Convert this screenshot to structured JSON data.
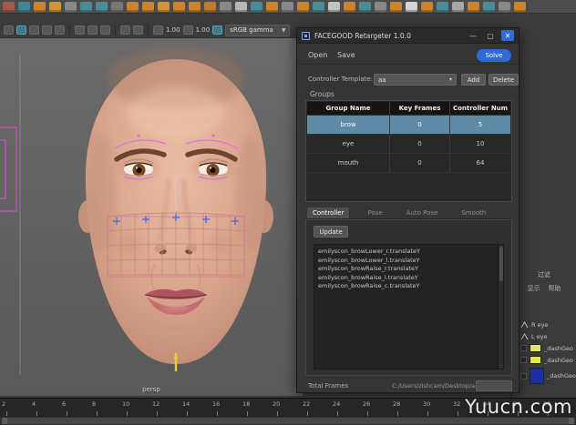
{
  "colors": {
    "accent_blue": "#2f6ad9",
    "selection": "#5e8aa6"
  },
  "watermark": "Yuucn.com",
  "shelf": {
    "icon_colors": [
      "#b05a4a",
      "#3f8e9a",
      "#d9882a",
      "#e09a33",
      "#8f8f8f",
      "#49939e",
      "#49939e",
      "#7a7a7a",
      "#d9882a",
      "#d9882a",
      "#e09a33",
      "#d9882a",
      "#d9882a",
      "#c97f28",
      "#8f8f8f",
      "#bfbfbf",
      "#49939e",
      "#d9882a",
      "#8f8f8f",
      "#d9882a",
      "#49939e",
      "#cccccc",
      "#d9882a",
      "#49939e",
      "#8f8f8f",
      "#d9882a",
      "#e0e0e0",
      "#d9882a",
      "#49939e",
      "#b0b0b0",
      "#d9882a",
      "#49939e",
      "#8f8f8f",
      "#d9882a"
    ]
  },
  "viewport_toolbar": {
    "group1": [
      {
        "name": "camera-select-icon",
        "active": false
      },
      {
        "name": "camera-lock-icon",
        "active": true
      },
      {
        "name": "film-gate-icon",
        "active": false
      },
      {
        "name": "resolution-gate-icon",
        "active": false
      },
      {
        "name": "gate-mask-icon",
        "active": false
      }
    ],
    "group2": [
      {
        "name": "field-chart-icon",
        "active": false
      },
      {
        "name": "safe-action-icon",
        "active": false
      },
      {
        "name": "safe-title-icon",
        "active": false
      }
    ],
    "group3": [
      {
        "name": "isolate-select-icon",
        "active": false
      },
      {
        "name": "xray-icon",
        "active": false
      }
    ],
    "exposure": "1.00",
    "gamma": "1.00",
    "colorspace": "sRGB gamma"
  },
  "viewport": {
    "camera_label": "persp"
  },
  "timeline": {
    "ticks": [
      "2",
      "4",
      "6",
      "8",
      "10",
      "12",
      "14",
      "16",
      "18",
      "20",
      "22",
      "24",
      "26",
      "28",
      "30",
      "32",
      "34",
      "36",
      "38"
    ]
  },
  "dialog": {
    "title": "FACEGOOD Retargeter 1.0.0",
    "window_controls": {
      "minimize": "—",
      "maximize": "▢",
      "close": "✕"
    },
    "menu": {
      "open": "Open",
      "save": "Save"
    },
    "solve_button": "Solve",
    "controller_template": {
      "label": "Controller Template:",
      "value": "aa",
      "caret": "▾",
      "add": "Add",
      "delete": "Delete"
    },
    "groups_label": "Groups",
    "table": {
      "headers": [
        "Group Name",
        "Key Frames",
        "Controller Num"
      ],
      "rows": [
        {
          "name": "brow",
          "key_frames": "0",
          "controller_num": "5"
        },
        {
          "name": "eye",
          "key_frames": "0",
          "controller_num": "10"
        },
        {
          "name": "mouth",
          "key_frames": "0",
          "controller_num": "64"
        }
      ]
    },
    "tabs": [
      "Controller",
      "Pose",
      "Auto Pose",
      "Smooth"
    ],
    "update_button": "Update",
    "controllers": [
      "emilyscon_browLower_r.translateY",
      "emilyscon_browLower_l.translateY",
      "emilyscon_browRaise_r.translateY",
      "emilyscon_browRaise_l.translateY",
      "emilyscon_browRaise_c.translateY"
    ],
    "status": {
      "total_frames_label": "Total Frames",
      "path": "C:/Users/zlshcam/Desktop/a"
    }
  },
  "right_panel": {
    "menu_line1": "过滤",
    "menu_line2a": "显示",
    "menu_line2b": "帮助",
    "layers": [
      {
        "label": "R eye"
      },
      {
        "label": "L eye"
      },
      {
        "label": "_dashGeo"
      },
      {
        "label": "_dashGeo"
      },
      {
        "label": "_dashGeo"
      }
    ]
  }
}
